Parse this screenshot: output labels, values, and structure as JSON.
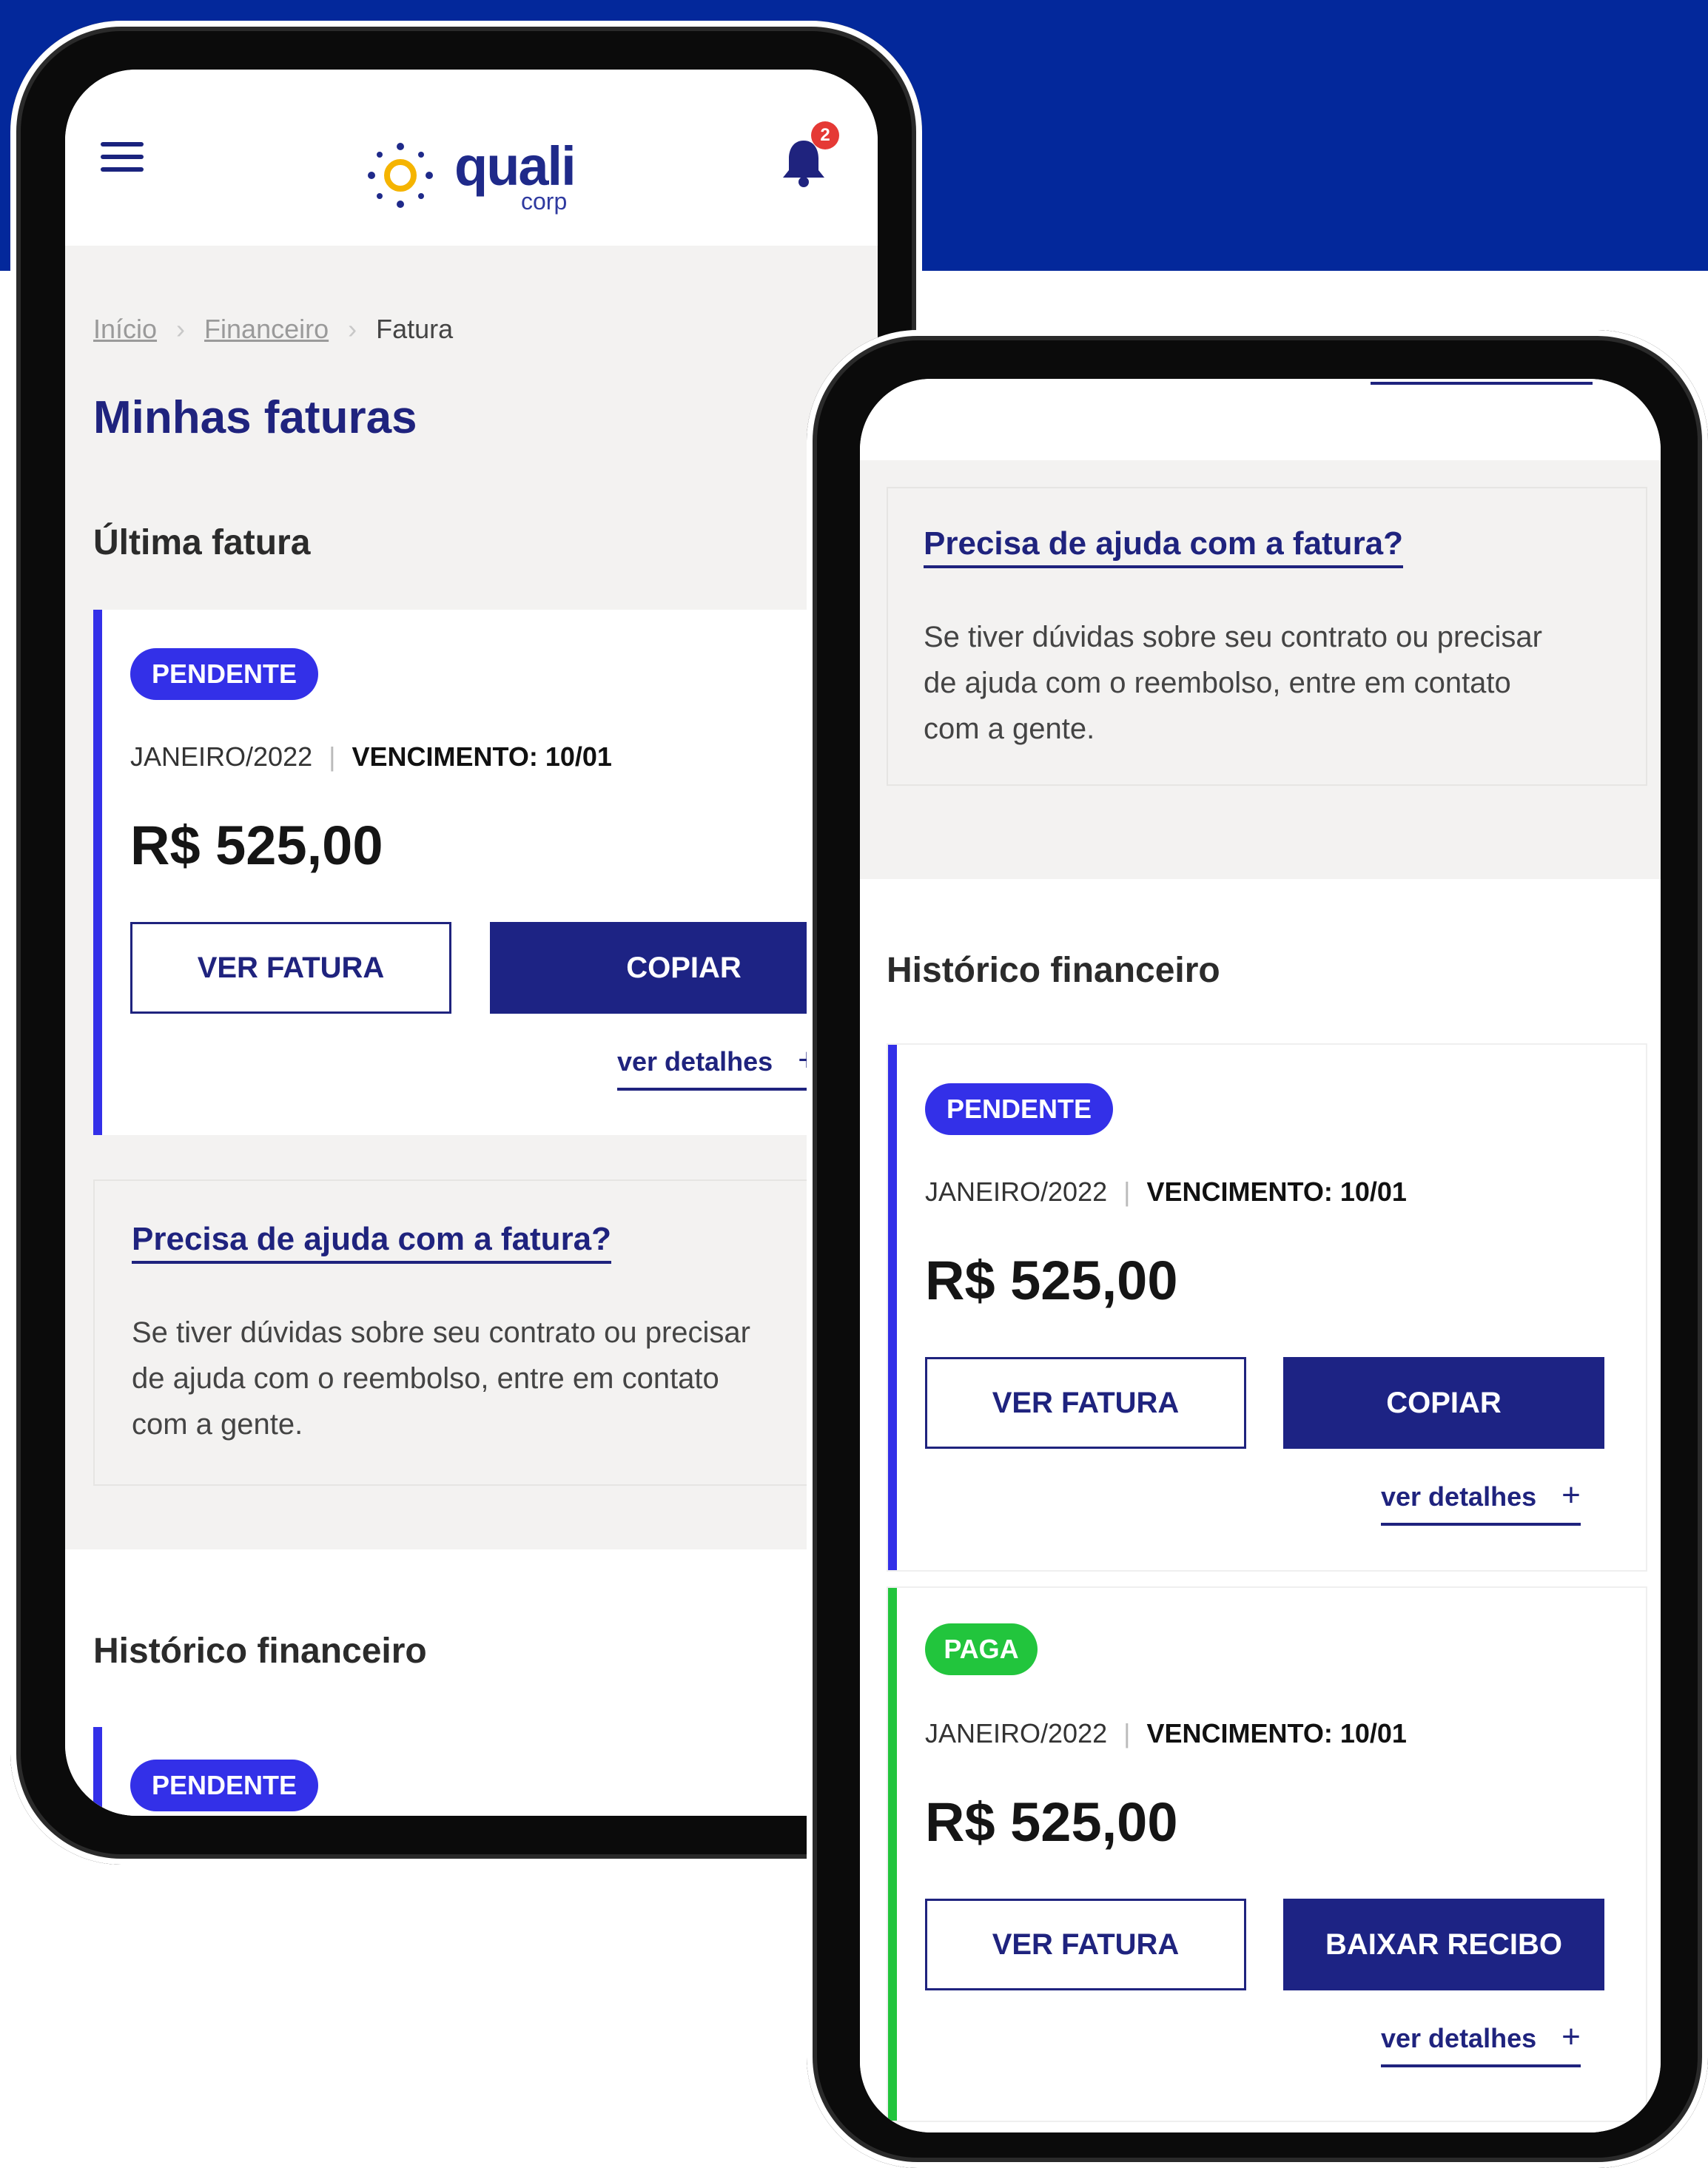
{
  "app": {
    "logo_text": "quali",
    "logo_sub": "corp",
    "notification_count": "2"
  },
  "breadcrumb": {
    "items": [
      "Início",
      "Financeiro",
      "Fatura"
    ]
  },
  "page": {
    "title": "Minhas faturas",
    "last_invoice_title": "Última fatura",
    "history_title": "Histórico financeiro"
  },
  "invoice_pending": {
    "status": "PENDENTE",
    "period": "JANEIRO/2022",
    "due": "VENCIMENTO: 10/01",
    "amount": "R$ 525,00",
    "view_label": "VER FATURA",
    "copy_label": "COPIAR",
    "details_label": "ver detalhes",
    "details_icon": "+"
  },
  "invoice_paid": {
    "status": "PAGA",
    "period": "JANEIRO/2022",
    "due": "VENCIMENTO: 10/01",
    "amount": "R$ 525,00",
    "view_label": "VER FATURA",
    "receipt_label": "BAIXAR RECIBO",
    "details_label": "ver detalhes",
    "details_icon": "+"
  },
  "help": {
    "title": "Precisa de ajuda com a fatura?",
    "text": "Se tiver dúvidas sobre seu contrato ou precisar de ajuda com o reembolso, entre em contato com a gente."
  },
  "colors": {
    "brand_dark": "#1d2384",
    "band_blue": "#03289b",
    "pending": "#3330e8",
    "paid": "#22c53d"
  }
}
